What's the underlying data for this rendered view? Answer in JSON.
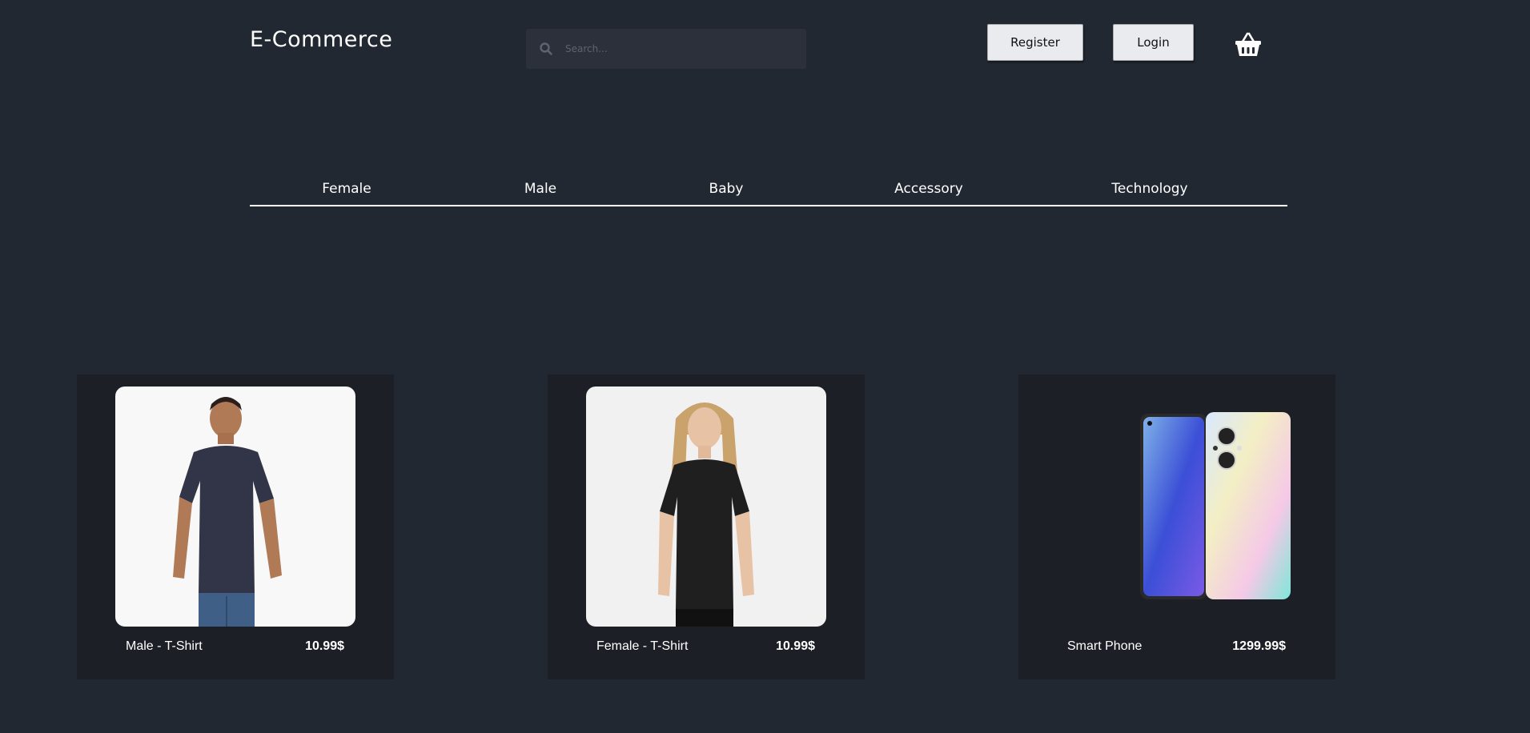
{
  "header": {
    "logo": "E-Commerce",
    "search_placeholder": "Search...",
    "register_label": "Register",
    "login_label": "Login",
    "cart_icon": "shopping-basket-icon"
  },
  "nav": {
    "items": [
      "Female",
      "Male",
      "Baby",
      "Accessory",
      "Technology"
    ]
  },
  "products": [
    {
      "name": "Male - T-Shirt",
      "price": "10.99$"
    },
    {
      "name": "Female - T-Shirt",
      "price": "10.99$"
    },
    {
      "name": "Smart Phone",
      "price": "1299.99$"
    }
  ],
  "colors": {
    "background": "#222831",
    "card": "#1c1f26",
    "search": "#2b303a",
    "button": "#eaebee"
  }
}
